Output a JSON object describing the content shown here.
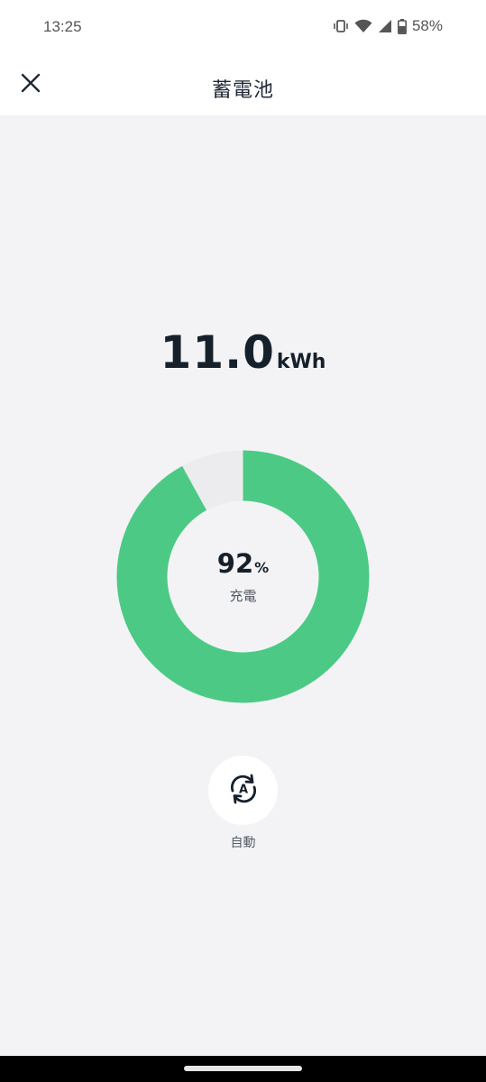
{
  "status_bar": {
    "time": "13:25",
    "battery": "58%",
    "icons": [
      "vibrate-icon",
      "wifi-icon",
      "signal-icon",
      "battery-icon"
    ]
  },
  "app_bar": {
    "title": "蓄電池",
    "close_icon": "close-icon"
  },
  "battery": {
    "energy_value": "11.0",
    "energy_unit": "kWh",
    "charge_percent": 92,
    "percent_display": "92",
    "percent_unit": "%",
    "state_label": "充電",
    "fill_color": "#4cca85",
    "empty_color": "#ececee"
  },
  "mode": {
    "label": "自動",
    "icon": "auto-mode-icon",
    "icon_letter": "A"
  }
}
